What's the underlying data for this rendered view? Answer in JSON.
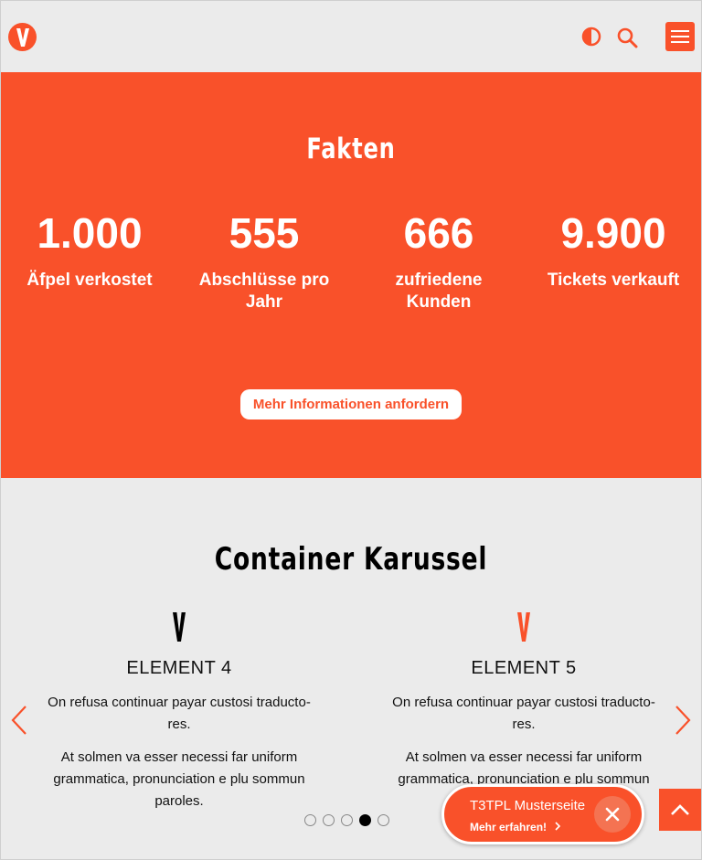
{
  "colors": {
    "accent": "#f9512a",
    "background": "#ebebeb",
    "text": "#111111"
  },
  "header": {
    "logo_icon": "v-logo-icon",
    "contrast_icon": "contrast-icon",
    "search_icon": "search-icon",
    "menu_icon": "hamburger-icon"
  },
  "facts": {
    "title": "Fakten",
    "items": [
      {
        "number": "1.000",
        "label": "Äfpel verkostet"
      },
      {
        "number": "555",
        "label": "Abschlüsse pro Jahr"
      },
      {
        "number": "666",
        "label": "zufriedene Kunden"
      },
      {
        "number": "9.900",
        "label": "Tickets verkauft"
      }
    ],
    "cta_label": "Mehr Informationen anfordern"
  },
  "carousel": {
    "title": "Container Karussel",
    "slides": [
      {
        "logo_color": "#000000",
        "heading": "ELEMENT 4",
        "text1": "On refusa continuar payar custosi traducto­res.",
        "text2": "At solmen va esser necessi far uniform gram­matica, pronunciation e plu sommun paroles."
      },
      {
        "logo_color": "#f9512a",
        "heading": "ELEMENT 5",
        "text1": "On refusa continuar payar custosi traducto­res.",
        "text2": "At solmen va esser necessi far uniform gram­matica, pronunciation e plu sommun paroles."
      }
    ],
    "prev_icon": "chevron-left-icon",
    "next_icon": "chevron-right-icon",
    "dot_count": 5,
    "active_dot": 4
  },
  "popup": {
    "title": "T3TPL Musterseite",
    "link": "Mehr erfahren!",
    "close_icon": "close-icon"
  },
  "back_to_top_icon": "chevron-up-icon"
}
